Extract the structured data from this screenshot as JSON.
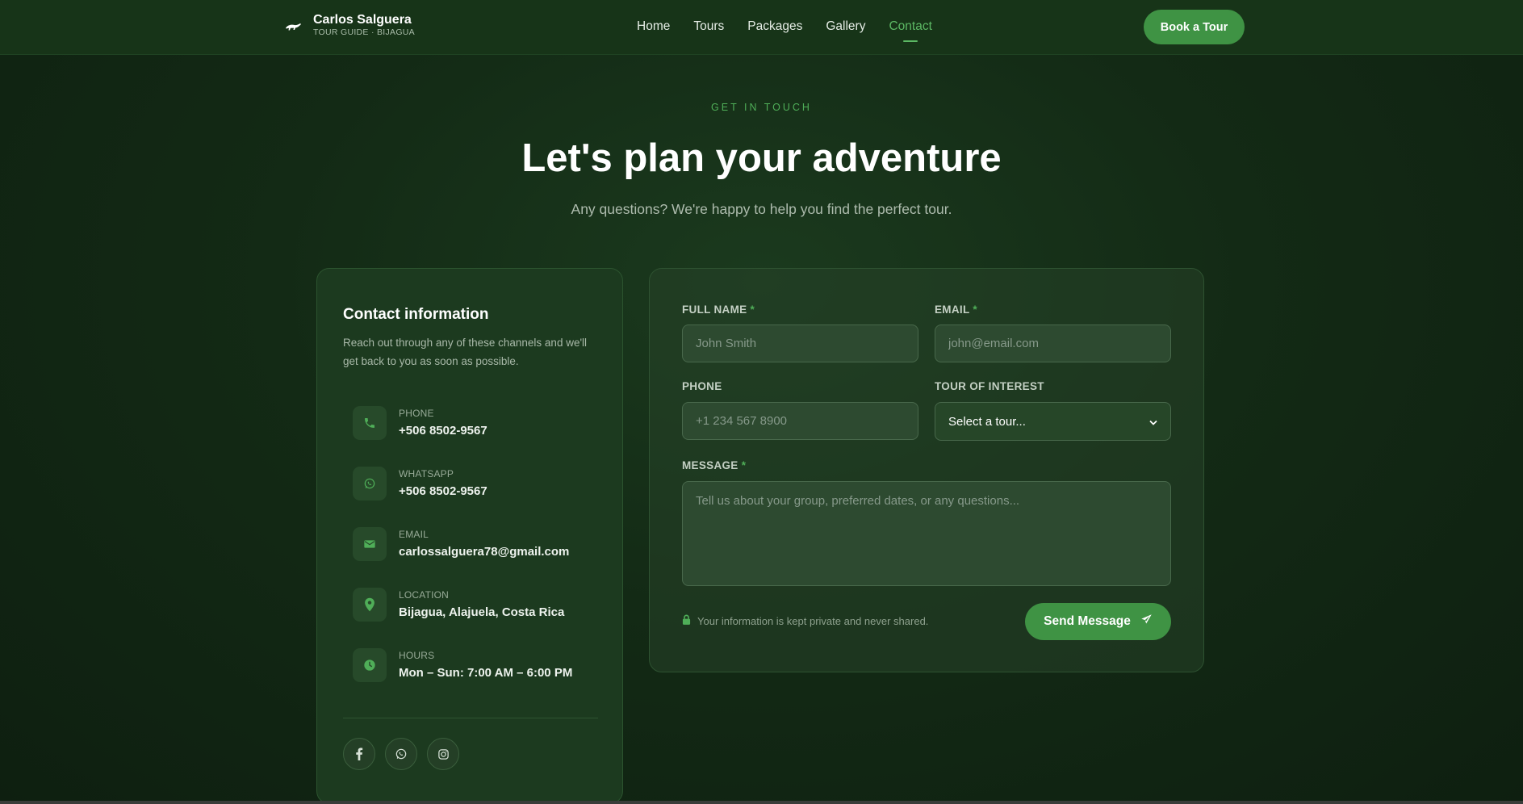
{
  "header": {
    "brand_name": "Carlos Salguera",
    "brand_sub": "TOUR GUIDE · BIJAGUA",
    "brand_icon": "sloth-icon",
    "nav": [
      "Home",
      "Tours",
      "Packages",
      "Gallery",
      "Contact"
    ],
    "active_nav": "Contact",
    "cta_label": "Book a Tour"
  },
  "hero": {
    "eyebrow": "GET IN TOUCH",
    "title": "Let's plan your adventure",
    "subtitle": "Any questions? We're happy to help you find the perfect tour."
  },
  "info": {
    "title": "Contact information",
    "description": "Reach out through any of these channels and we'll get back to you as soon as possible.",
    "items": [
      {
        "label": "PHONE",
        "value": "+506 8502-9567",
        "icon": "phone-icon"
      },
      {
        "label": "WHATSAPP",
        "value": "+506 8502-9567",
        "icon": "whatsapp-icon"
      },
      {
        "label": "EMAIL",
        "value": "carlossalguera78@gmail.com",
        "icon": "envelope-icon"
      },
      {
        "label": "LOCATION",
        "value": "Bijagua, Alajuela, Costa Rica",
        "icon": "map-pin-icon"
      },
      {
        "label": "HOURS",
        "value": "Mon – Sun: 7:00 AM – 6:00 PM",
        "icon": "clock-icon"
      }
    ],
    "social": [
      "facebook-icon",
      "whatsapp-icon",
      "instagram-icon"
    ]
  },
  "form": {
    "full_name_label": "FULL NAME",
    "full_name_placeholder": "John Smith",
    "email_label": "EMAIL",
    "email_placeholder": "john@email.com",
    "phone_label": "PHONE",
    "phone_placeholder": "+1 234 567 8900",
    "tour_label": "TOUR OF INTEREST",
    "tour_selected": "Select a tour...",
    "message_label": "MESSAGE",
    "message_placeholder": "Tell us about your group, preferred dates, or any questions...",
    "required_mark": "*",
    "privacy": "Your information is kept private and never shared.",
    "send_label": "Send Message"
  },
  "colors": {
    "accent": "#3f9344",
    "accent_text": "#5cb864",
    "background": "#132a15",
    "card": "#1c3a1f"
  }
}
